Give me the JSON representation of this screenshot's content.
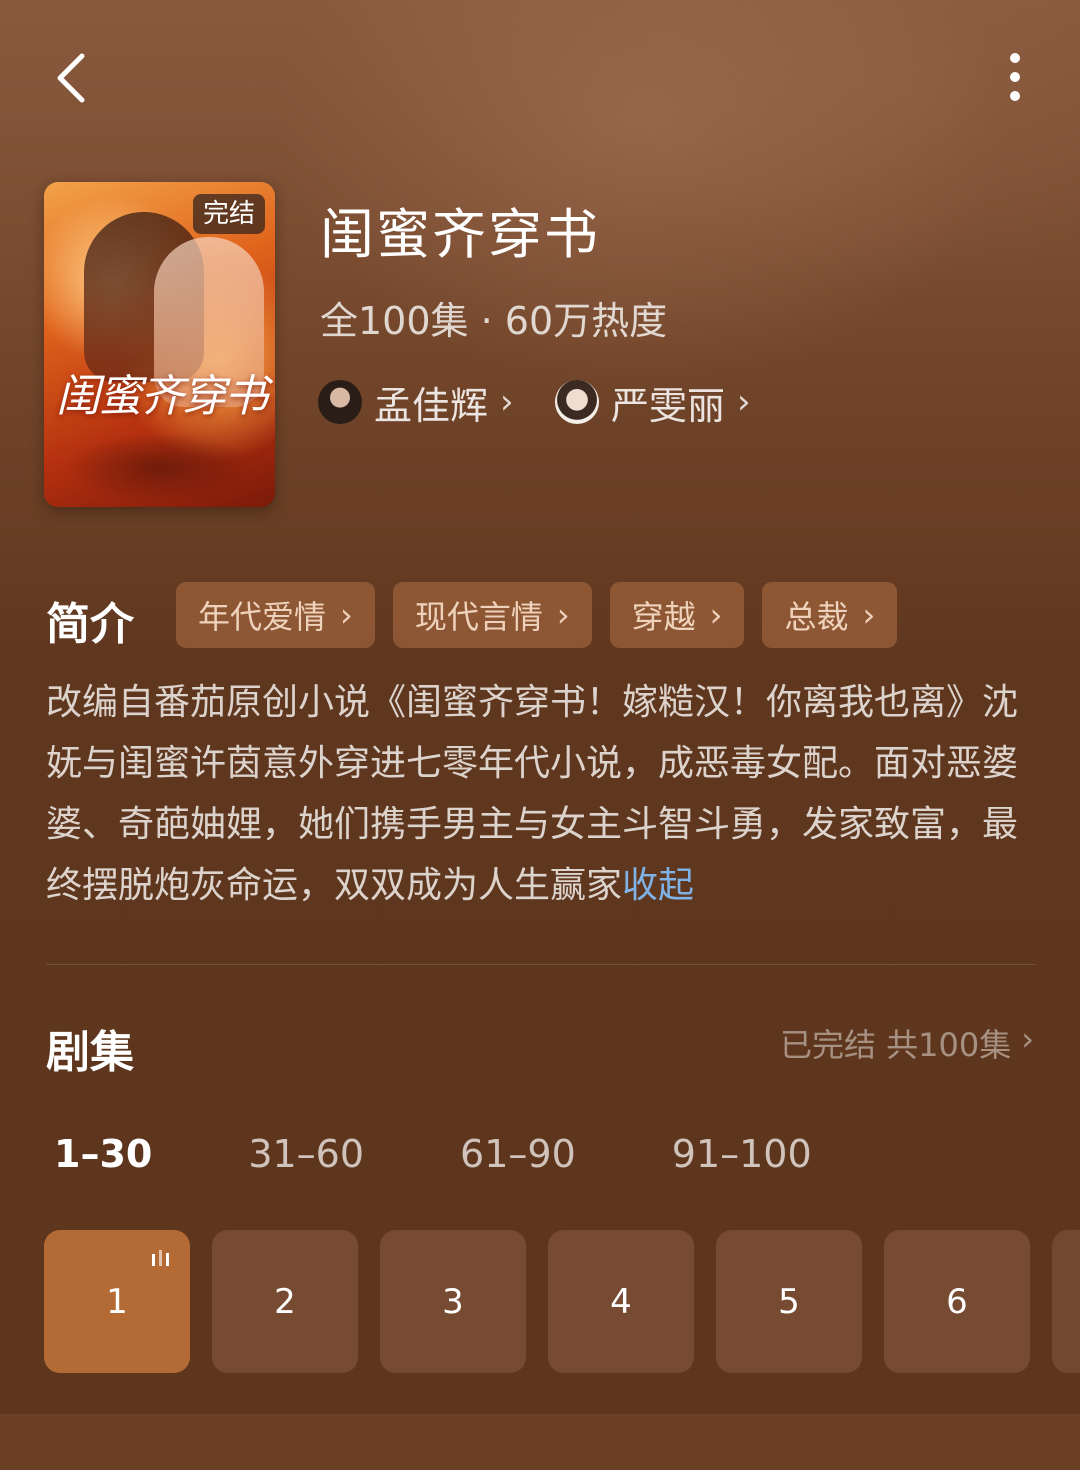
{
  "drama": {
    "title": "闺蜜齐穿书",
    "status_badge": "完结",
    "cover_title": "闺蜜齐穿书",
    "stats": "全100集 · 60万热度"
  },
  "actors": [
    {
      "name": "孟佳辉"
    },
    {
      "name": "严雯丽"
    }
  ],
  "intro": {
    "heading": "简介",
    "tags": [
      "年代爱情",
      "现代言情",
      "穿越",
      "总裁"
    ],
    "description": "改编自番茄原创小说《闺蜜齐穿书！嫁糙汉！你离我也离》沈妩与闺蜜许茵意外穿进七零年代小说，成恶毒女配。面对恶婆婆、奇葩妯娌，她们携手男主与女主斗智斗勇，发家致富，最终摆脱炮灰命运，双双成为人生赢家",
    "collapse_label": "收起"
  },
  "episodes": {
    "heading": "剧集",
    "status": "已完结 共100集",
    "ranges": [
      "1–30",
      "31–60",
      "61–90",
      "91–100"
    ],
    "active_range": 0,
    "items": [
      "1",
      "2",
      "3",
      "4",
      "5",
      "6"
    ],
    "current": "1"
  },
  "icons": {
    "back": "chevron-left-icon",
    "more": "more-vertical-icon",
    "playing": "playing-bars-icon",
    "chevron": "chevron-right-icon"
  },
  "colors": {
    "background": "#5e361d",
    "active_episode": "#b36a35",
    "collapse_link": "#7fb2e6"
  }
}
